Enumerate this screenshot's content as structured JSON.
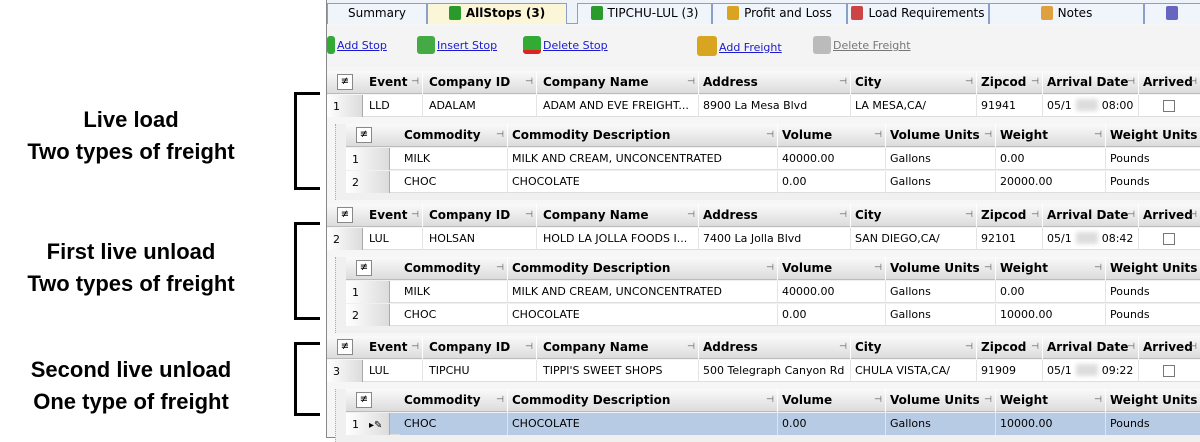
{
  "annotations": [
    {
      "line1": "Live load",
      "line2": "Two types of freight"
    },
    {
      "line1": "First live unload",
      "line2": "Two types of freight"
    },
    {
      "line1": "Second live unload",
      "line2": "One type of freight"
    }
  ],
  "tabs": [
    {
      "label": "Summary",
      "active": false,
      "icon": "none"
    },
    {
      "label": "AllStops (3)",
      "active": true,
      "icon": "green-box-icon"
    },
    {
      "label": "TIPCHU-LUL (3)",
      "active": false,
      "icon": "green-box-icon"
    },
    {
      "label": "Profit and Loss",
      "active": false,
      "icon": "money-bag-icon"
    },
    {
      "label": "Load Requirements",
      "active": false,
      "icon": "checklist-icon"
    },
    {
      "label": "Notes",
      "active": false,
      "icon": "pencil-icon"
    },
    {
      "label": "",
      "active": false,
      "icon": "edit-icon"
    }
  ],
  "toolbar": {
    "add_stop": "Add Stop",
    "insert_stop": "Insert Stop",
    "delete_stop": "Delete Stop",
    "add_freight": "Add Freight",
    "delete_freight": "Delete Freight"
  },
  "colors": {
    "link": "#1a1ad0",
    "tab_active": "#fbf6d8",
    "row_selected": "#b8cbe4"
  },
  "stop_columns": [
    "Event",
    "Company ID",
    "Company Name",
    "Address",
    "City",
    "Zipcod",
    "Arrival Date",
    "Arrived"
  ],
  "freight_columns": [
    "Commodity",
    "Commodity Description",
    "Volume",
    "Volume Units",
    "Weight",
    "Weight Units"
  ],
  "stops": [
    {
      "num": "1",
      "event": "LLD",
      "company_id": "ADALAM",
      "company_name": "ADAM AND EVE FREIGHT...",
      "address": "8900 La Mesa Blvd",
      "city": "LA MESA,CA/",
      "zip": "91941",
      "arrival_date": "05/1",
      "arrival_time": "08:00",
      "arrived": false,
      "freight": [
        {
          "num": "1",
          "commodity": "MILK",
          "description": "MILK AND CREAM, UNCONCENTRATED",
          "volume": "40000.00",
          "volume_units": "Gallons",
          "weight": "0.00",
          "weight_units": "Pounds"
        },
        {
          "num": "2",
          "commodity": "CHOC",
          "description": "CHOCOLATE",
          "volume": "0.00",
          "volume_units": "Gallons",
          "weight": "20000.00",
          "weight_units": "Pounds"
        }
      ]
    },
    {
      "num": "2",
      "event": "LUL",
      "company_id": "HOLSAN",
      "company_name": "HOLD LA JOLLA FOODS I...",
      "address": "7400 La Jolla Blvd",
      "city": "SAN DIEGO,CA/",
      "zip": "92101",
      "arrival_date": "05/1",
      "arrival_time": "08:42",
      "arrived": false,
      "freight": [
        {
          "num": "1",
          "commodity": "MILK",
          "description": "MILK AND CREAM, UNCONCENTRATED",
          "volume": "40000.00",
          "volume_units": "Gallons",
          "weight": "0.00",
          "weight_units": "Pounds"
        },
        {
          "num": "2",
          "commodity": "CHOC",
          "description": "CHOCOLATE",
          "volume": "0.00",
          "volume_units": "Gallons",
          "weight": "10000.00",
          "weight_units": "Pounds"
        }
      ]
    },
    {
      "num": "3",
      "event": "LUL",
      "company_id": "TIPCHU",
      "company_name": "TIPPI'S SWEET SHOPS",
      "address": "500 Telegraph Canyon Rd",
      "city": "CHULA VISTA,CA/",
      "zip": "91909",
      "arrival_date": "05/1",
      "arrival_time": "09:22",
      "arrived": false,
      "freight": [
        {
          "num": "1",
          "commodity": "CHOC",
          "description": "CHOCOLATE",
          "volume": "0.00",
          "volume_units": "Gallons",
          "weight": "10000.00",
          "weight_units": "Pounds",
          "selected": true
        }
      ]
    }
  ]
}
